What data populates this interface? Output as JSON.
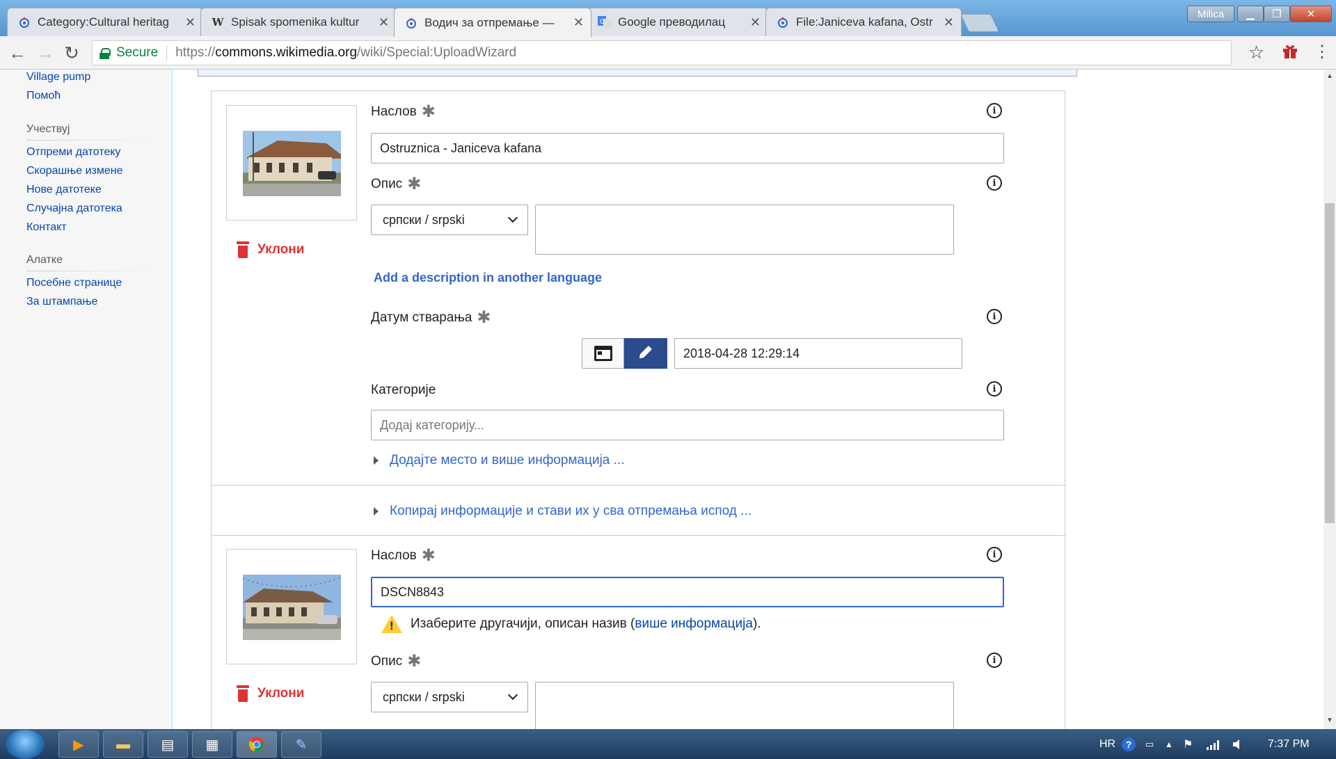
{
  "browser": {
    "tabs": [
      {
        "title": "Category:Cultural heritag",
        "icon": "commons-icon"
      },
      {
        "title": "Spisak spomenika kultur",
        "icon": "wikipedia-icon"
      },
      {
        "title": "Водич за отпремање —",
        "icon": "commons-icon"
      },
      {
        "title": "Google преводилац",
        "icon": "google-translate-icon"
      },
      {
        "title": "File:Janiceva kafana, Ostr",
        "icon": "commons-icon"
      }
    ],
    "user_badge": "Milica",
    "secure_label": "Secure",
    "url_scheme": "https://",
    "url_host": "commons.wikimedia.org",
    "url_path": "/wiki/Special:UploadWizard"
  },
  "sidebar": {
    "top_links": [
      "Village pump",
      "Помоћ"
    ],
    "participate_header": "Учествуј",
    "participate_links": [
      "Отпреми датотеку",
      "Скорашње измене",
      "Нове датотеке",
      "Случајна датотека",
      "Контакт"
    ],
    "tools_header": "Алатке",
    "tools_links": [
      "Посебне странице",
      "За штампање"
    ]
  },
  "upload1": {
    "remove_label": "Уклони",
    "title_label": "Наслов",
    "title_value": "Ostruznica - Janiceva kafana",
    "description_label": "Опис",
    "language_value": "српски / srpski",
    "add_description_link": "Add a description in another language",
    "date_label": "Датум стварања",
    "date_value": "2018-04-28 12:29:14",
    "categories_label": "Категорије",
    "categories_placeholder": "Додај категорију...",
    "more_info_expander": "Додајте место и више информација ..."
  },
  "copy_expander": "Копирај информације и стави их у сва отпремања испод ...",
  "upload2": {
    "remove_label": "Уклони",
    "title_label": "Наслов",
    "title_value": "DSCN8843",
    "warning_text": "Изаберите другачији, описан назив (",
    "warning_link": "више информација",
    "warning_end": ").",
    "description_label": "Опис",
    "language_value": "српски / srpski"
  },
  "taskbar": {
    "lang": "HR",
    "clock": "7:37 PM"
  }
}
